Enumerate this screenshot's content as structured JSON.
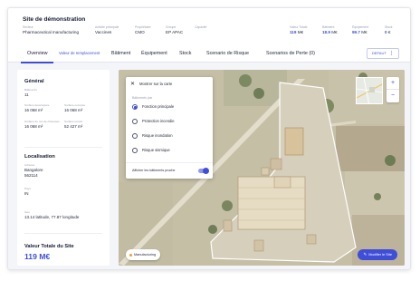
{
  "header": {
    "title": "Site de démonstration",
    "fields": [
      {
        "label": "Secteur",
        "value": "Pharmaceutical manufacturing"
      },
      {
        "label": "Activité principale",
        "value": "Vaccines"
      },
      {
        "label": "Propriétaire",
        "value": "CMO"
      },
      {
        "label": "Groupe",
        "value": "EP APAC"
      },
      {
        "label": "Capacité",
        "value": ""
      }
    ],
    "kpis": [
      {
        "label": "Valeur Totale",
        "value": "119",
        "unit": "M€"
      },
      {
        "label": "Bâtiment",
        "value": "18.9",
        "unit": "M€"
      },
      {
        "label": "Équipement",
        "value": "99.7",
        "unit": "M€"
      },
      {
        "label": "Stock",
        "value": "0",
        "unit": "€"
      }
    ]
  },
  "tabs": {
    "overview": "Overview",
    "replacement_value": "Valeur de remplacement",
    "building": "Bâtiment",
    "equipment": "Équipement",
    "stock": "Stock",
    "risk_scenario": "Scenario de Risque",
    "loss_scenario": "Scenarios de Perte (0)",
    "default_button": "DEFAUT",
    "default_menu_icon": "more-vert-icon"
  },
  "panel": {
    "general": {
      "title": "Général",
      "buildings_label": "Bâtiments",
      "buildings_value": "11",
      "developed_area_label": "Surface développée",
      "developed_area_value": "16 068 m²",
      "occupied_area_label": "Surface occupée",
      "occupied_area_value": "16 068 m²",
      "ground_floor_area_label": "Surface du rez-de-chaussée",
      "ground_floor_area_value": "16 068 m²",
      "land_area_label": "Surface terrain",
      "land_area_value": "52 427 m²"
    },
    "location": {
      "title": "Localisation",
      "address_label": "Adresse",
      "address_line1": "Bangalore",
      "address_line2": "562114",
      "country_label": "Pays",
      "country_value": "IN",
      "geo_label": "Géo",
      "latitude": "13.14 latitude,",
      "longitude": "77.87 longitude"
    },
    "total": {
      "label": "Valeur Totale du Site",
      "value": "119 M€"
    }
  },
  "map": {
    "popup": {
      "show_on_map": "Montrer sur la carte",
      "close_icon": "close-icon",
      "group_label": "Bâtiments par",
      "options": [
        {
          "label": "Fonction principale",
          "selected": true
        },
        {
          "label": "Protection incendie",
          "selected": false
        },
        {
          "label": "Risque inondation",
          "selected": false
        },
        {
          "label": "Risque sismique",
          "selected": false
        }
      ],
      "toggle_label": "Afficher les bâtiments proche",
      "toggle_on": true
    },
    "zoom_in": "+",
    "zoom_out": "−",
    "legend_chip": "Manufacturing",
    "legend_color": "#f29a33",
    "edit_button": "Modifier le Site",
    "edit_icon": "pencil-icon"
  },
  "colors": {
    "accent": "#3f4ed8",
    "panel_bg": "#f4f5f9"
  }
}
